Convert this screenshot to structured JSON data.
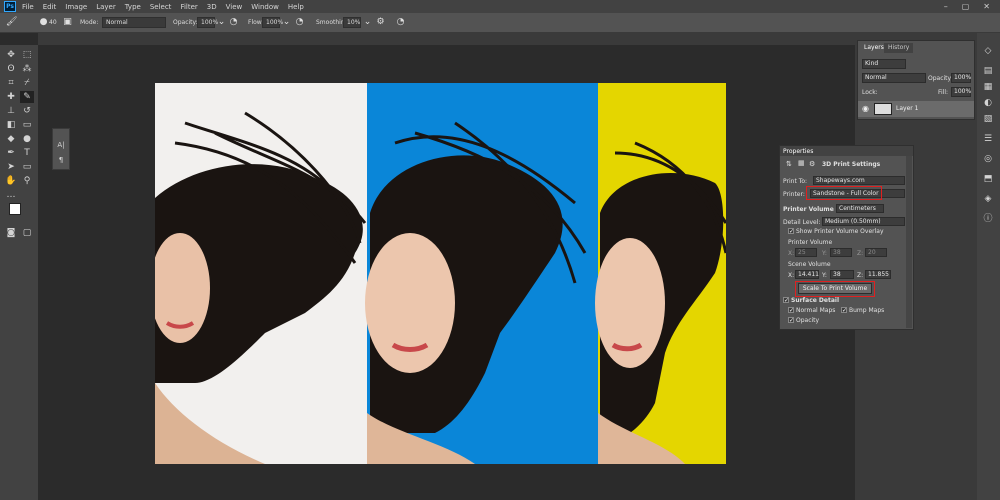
{
  "menubar": {
    "app_logo": "Ps",
    "items": [
      "File",
      "Edit",
      "Image",
      "Layer",
      "Type",
      "Select",
      "Filter",
      "3D",
      "View",
      "Window",
      "Help"
    ],
    "window_controls": [
      "–",
      "▢",
      "✕"
    ]
  },
  "options": {
    "brush_size": "40",
    "mode_label": "Mode:",
    "mode_value": "Normal",
    "opacity_label": "Opacity:",
    "opacity_value": "100%",
    "flow_label": "Flow:",
    "flow_value": "100%",
    "smoothing_label": "Smoothing:",
    "smoothing_value": "10%"
  },
  "layers_panel": {
    "tabs": [
      "Layers",
      "History"
    ],
    "kind_value": "Kind",
    "blend_value": "Normal",
    "opacity_label": "Opacity:",
    "opacity_value": "100%",
    "lock_label": "Lock:",
    "fill_label": "Fill:",
    "fill_value": "100%",
    "layer_name": "Layer 1"
  },
  "properties": {
    "tab": "Properties",
    "title": "3D Print Settings",
    "print_to_label": "Print To:",
    "print_to_value": "Shapeways.com",
    "printer_label": "Printer:",
    "printer_value": "Sandstone - Full Color",
    "printer_volume_label": "Printer Volume",
    "printer_volume_units": "Centimeters",
    "detail_label": "Detail Level:",
    "detail_value": "Medium (0.50mm)",
    "show_overlay": "Show Printer Volume Overlay",
    "printer_volume_sub": "Printer Volume",
    "pv_x_label": "X:",
    "pv_x": "25",
    "pv_y_label": "Y:",
    "pv_y": "38",
    "pv_z_label": "Z:",
    "pv_z": "20",
    "scene_volume": "Scene Volume",
    "sv_x_label": "X:",
    "sv_x": "14.411",
    "sv_y_label": "Y:",
    "sv_y": "38",
    "sv_z_label": "Z:",
    "sv_z": "11.855",
    "scale_button": "Scale To Print Volume",
    "surface_detail": "Surface Detail",
    "normal_maps": "Normal Maps",
    "bump_maps": "Bump Maps",
    "opacity": "Opacity"
  },
  "mini_panel": {
    "char_icon": "A|",
    "para_icon": "¶"
  },
  "colors": {
    "white_panel": "#f2f0ee",
    "blue_panel": "#0a86d8",
    "yellow_panel": "#e4d600",
    "highlight": "#e02020"
  }
}
